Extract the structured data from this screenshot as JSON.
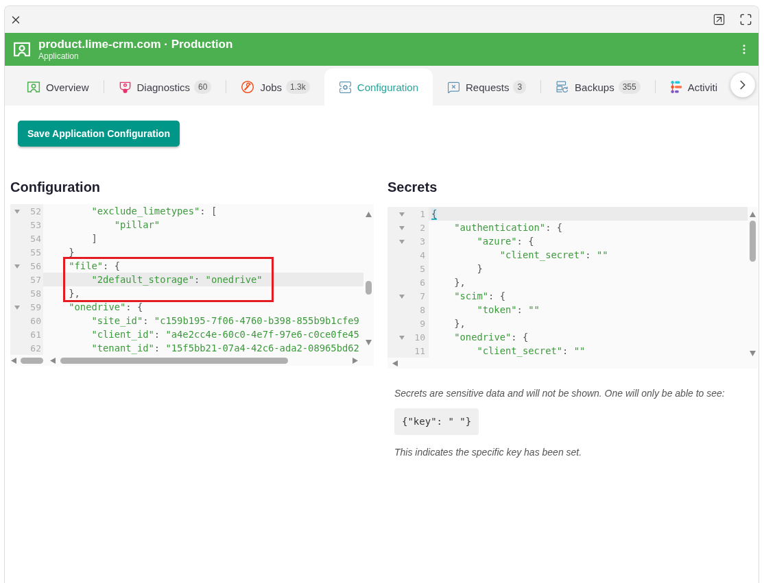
{
  "header": {
    "title": "product.lime-crm.com · Production",
    "subtitle": "Application"
  },
  "tabs": [
    {
      "label": "Overview",
      "selected": false
    },
    {
      "label": "Diagnostics",
      "badge": "60",
      "selected": false
    },
    {
      "label": "Jobs",
      "badge": "1.3k",
      "selected": false
    },
    {
      "label": "Configuration",
      "selected": true
    },
    {
      "label": "Requests",
      "badge": "3",
      "selected": false
    },
    {
      "label": "Backups",
      "badge": "355",
      "selected": false
    },
    {
      "label": "Activiti",
      "selected": false
    }
  ],
  "save_button": {
    "label": "Save Application Configuration"
  },
  "configuration": {
    "title": "Configuration",
    "editor": {
      "focused": false,
      "lines": [
        {
          "number": "52",
          "text": "        \"exclude_limetypes\": [",
          "foldable": true,
          "active": false,
          "marked": false
        },
        {
          "number": "53",
          "text": "            \"pillar\"",
          "foldable": false,
          "active": false,
          "marked": false
        },
        {
          "number": "54",
          "text": "        ]",
          "foldable": false,
          "active": false,
          "marked": false
        },
        {
          "number": "55",
          "text": "    }",
          "foldable": false,
          "active": false,
          "marked": false
        },
        {
          "number": "56",
          "text": "    \"file\": {",
          "foldable": true,
          "active": false,
          "marked": true
        },
        {
          "number": "57",
          "text": "        \"2default_storage\": \"onedrive\"",
          "foldable": false,
          "active": true,
          "marked": true
        },
        {
          "number": "58",
          "text": "    },",
          "foldable": false,
          "active": false,
          "marked": true
        },
        {
          "number": "59",
          "text": "    \"onedrive\": {",
          "foldable": true,
          "active": false,
          "marked": false
        },
        {
          "number": "60",
          "text": "        \"site_id\": \"c159b195-7f06-4760-b398-855b9b1cfe9",
          "foldable": false,
          "active": false,
          "marked": false
        },
        {
          "number": "61",
          "text": "        \"client_id\": \"a4e2cc4e-60c0-4e7f-97e6-c0ce0fe45",
          "foldable": false,
          "active": false,
          "marked": false
        },
        {
          "number": "62",
          "text": "        \"tenant_id\": \"15f5bb21-07a4-42c6-ada2-08965bd62",
          "foldable": false,
          "active": false,
          "marked": false
        }
      ]
    }
  },
  "secrets": {
    "title": "Secrets",
    "editor": {
      "focused": true,
      "lines": [
        {
          "number": "1",
          "text": "{",
          "foldable": true,
          "active": true
        },
        {
          "number": "2",
          "text": "    \"authentication\": {",
          "foldable": true,
          "active": false
        },
        {
          "number": "3",
          "text": "        \"azure\": {",
          "foldable": true,
          "active": false
        },
        {
          "number": "4",
          "text": "            \"client_secret\": \"\"",
          "foldable": false,
          "active": false
        },
        {
          "number": "5",
          "text": "        }",
          "foldable": false,
          "active": false
        },
        {
          "number": "6",
          "text": "    },",
          "foldable": false,
          "active": false
        },
        {
          "number": "7",
          "text": "    \"scim\": {",
          "foldable": true,
          "active": false
        },
        {
          "number": "8",
          "text": "        \"token\": \"\"",
          "foldable": false,
          "active": false
        },
        {
          "number": "9",
          "text": "    },",
          "foldable": false,
          "active": false
        },
        {
          "number": "10",
          "text": "    \"onedrive\": {",
          "foldable": true,
          "active": false
        },
        {
          "number": "11",
          "text": "        \"client_secret\": \"\"",
          "foldable": false,
          "active": false
        }
      ]
    },
    "note": "Secrets are sensitive data and will not be shown. One will only be able to see:",
    "example": "{\"key\": \" \"}",
    "footnote": "This indicates the specific key has been set."
  }
}
